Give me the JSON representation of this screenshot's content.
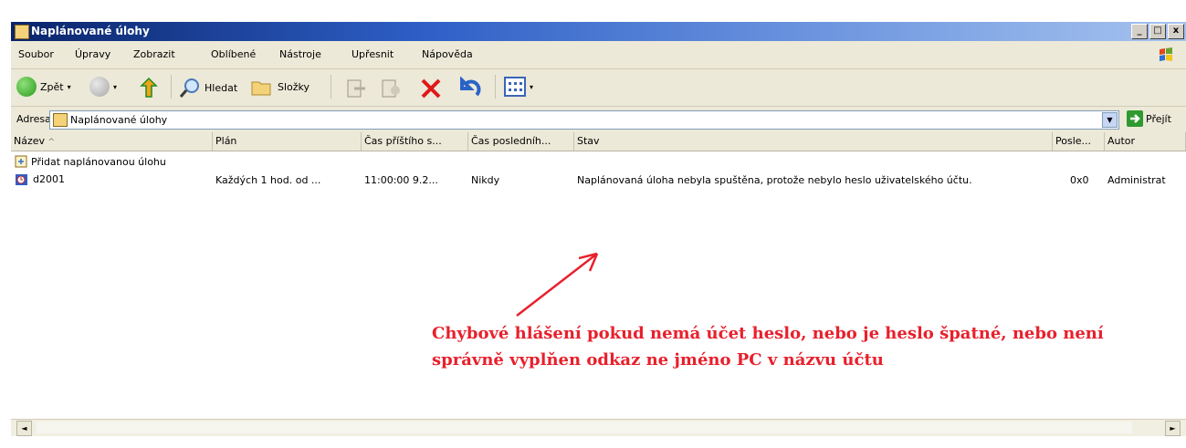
{
  "window": {
    "title": "Naplánované úlohy",
    "minimize": "_",
    "maximize": "□",
    "close": "x"
  },
  "menu": [
    "Soubor",
    "Úpravy",
    "Zobrazit",
    "Oblíbené",
    "Nástroje",
    "Upřesnit",
    "Nápověda"
  ],
  "toolbar": {
    "back": "Zpět",
    "search": "Hledat",
    "folders": "Složky"
  },
  "address": {
    "label": "Adresa",
    "value": "Naplánované úlohy",
    "go": "Přejít"
  },
  "columns": [
    "Název",
    "Plán",
    "Čas příštího s...",
    "Čas posledníh...",
    "Stav",
    "Posle...",
    "Autor"
  ],
  "items": [
    {
      "name": "Přidat naplánovanou úlohu"
    },
    {
      "name": "d2001",
      "plan": "Každých 1 hod. od ...",
      "next": "11:00:00 9.2...",
      "last": "Nikdy",
      "status": "Naplánovaná úloha nebyla spuštěna, protože nebylo heslo uživatelského účtu.",
      "result": "0x0",
      "author": "Administrat"
    }
  ],
  "annotation": {
    "line1": "Chybové hlášení pokud nemá účet heslo, nebo je heslo špatné, nebo není",
    "line2": "správně vyplňen odkaz ne jméno PC v názvu účtu",
    "color": "#e8202c"
  }
}
